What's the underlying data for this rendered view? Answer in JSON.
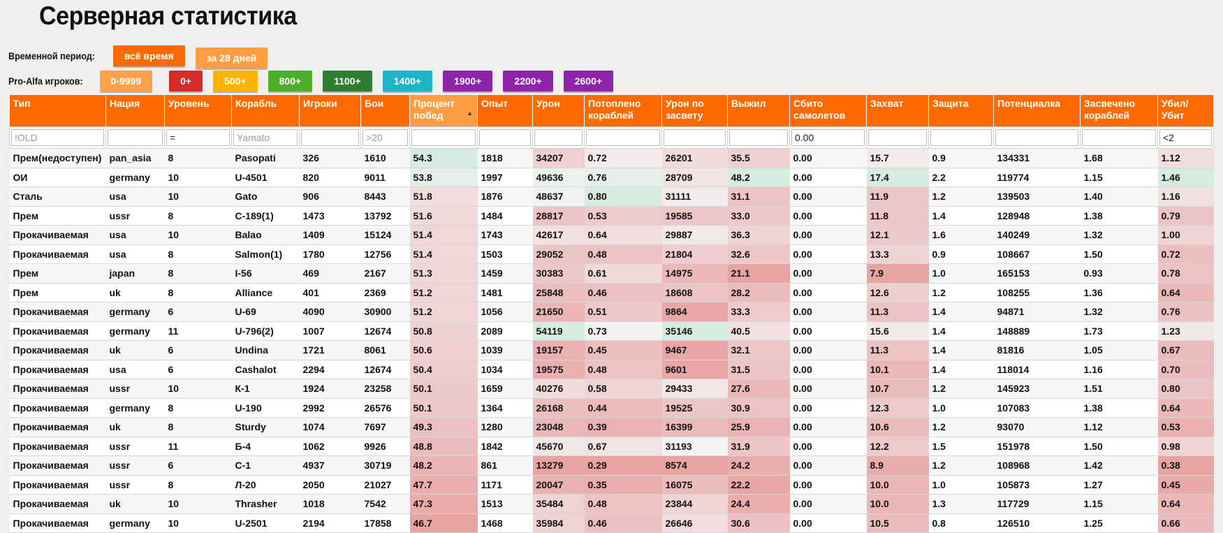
{
  "title": "Серверная статистика",
  "period": {
    "label": "Временной период:",
    "buttons": [
      {
        "label": "всё время",
        "color": "#ff6a00"
      },
      {
        "label": "за 28 дней",
        "color": "#ff9d45"
      }
    ]
  },
  "players": {
    "label": "Pro-Alfa игроков:",
    "buttons": [
      {
        "label": "0-9999",
        "color": "#ffa04a"
      },
      {
        "label": "0+",
        "color": "#d42b2b"
      },
      {
        "label": "500+",
        "color": "#ffb300"
      },
      {
        "label": "800+",
        "color": "#4caf2a"
      },
      {
        "label": "1100+",
        "color": "#2e7d32"
      },
      {
        "label": "1400+",
        "color": "#1eb5c9"
      },
      {
        "label": "1900+",
        "color": "#8e24aa"
      },
      {
        "label": "2200+",
        "color": "#8e24aa"
      },
      {
        "label": "2600+",
        "color": "#8e24aa"
      }
    ]
  },
  "columns": [
    {
      "label": "Тип",
      "filter": "",
      "placeholder": "!OLD"
    },
    {
      "label": "Нация",
      "filter": "",
      "placeholder": ""
    },
    {
      "label": "Уровень",
      "filter": "=",
      "placeholder": ""
    },
    {
      "label": "Корабль",
      "filter": "",
      "placeholder": "Yamato"
    },
    {
      "label": "Игроки",
      "filter": "",
      "placeholder": ""
    },
    {
      "label": "Бои",
      "filter": "",
      "placeholder": ">20"
    },
    {
      "label": "Процент побед",
      "filter": "",
      "placeholder": "",
      "sorted": true
    },
    {
      "label": "Опыт",
      "filter": "",
      "placeholder": ""
    },
    {
      "label": "Урон",
      "filter": "",
      "placeholder": ""
    },
    {
      "label": "Потоплено кораблей",
      "filter": "",
      "placeholder": ""
    },
    {
      "label": "Урон по засвету",
      "filter": "",
      "placeholder": ""
    },
    {
      "label": "Выжил",
      "filter": "",
      "placeholder": ""
    },
    {
      "label": "Сбито самолетов",
      "filter": "0.00",
      "placeholder": ""
    },
    {
      "label": "Захват",
      "filter": "",
      "placeholder": ""
    },
    {
      "label": "Защита",
      "filter": "",
      "placeholder": ""
    },
    {
      "label": "Потенциалка",
      "filter": "",
      "placeholder": ""
    },
    {
      "label": "Засвечено кораблей",
      "filter": "",
      "placeholder": ""
    },
    {
      "label": "Убил/ Убит",
      "filter": "<2",
      "placeholder": ""
    }
  ],
  "rows": [
    [
      "Прем(недоступен)",
      "pan_asia",
      "8",
      "Pasopati",
      "326",
      "1610",
      "54.3",
      "1818",
      "34207",
      "0.72",
      "26201",
      "35.5",
      "0.00",
      "15.7",
      "0.9",
      "134331",
      "1.68",
      "1.12"
    ],
    [
      "ОИ",
      "germany",
      "10",
      "U-4501",
      "820",
      "9011",
      "53.8",
      "1997",
      "49636",
      "0.76",
      "28709",
      "48.2",
      "0.00",
      "17.4",
      "2.2",
      "119774",
      "1.15",
      "1.46"
    ],
    [
      "Сталь",
      "usa",
      "10",
      "Gato",
      "906",
      "8443",
      "51.8",
      "1876",
      "48637",
      "0.80",
      "31111",
      "31.1",
      "0.00",
      "11.9",
      "1.2",
      "139503",
      "1.40",
      "1.16"
    ],
    [
      "Прем",
      "ussr",
      "8",
      "С-189(1)",
      "1473",
      "13792",
      "51.6",
      "1484",
      "28817",
      "0.53",
      "19585",
      "33.0",
      "0.00",
      "11.8",
      "1.4",
      "128948",
      "1.38",
      "0.79"
    ],
    [
      "Прокачиваемая",
      "usa",
      "10",
      "Balao",
      "1409",
      "15124",
      "51.4",
      "1743",
      "42617",
      "0.64",
      "29887",
      "36.3",
      "0.00",
      "12.1",
      "1.6",
      "140249",
      "1.32",
      "1.00"
    ],
    [
      "Прокачиваемая",
      "usa",
      "8",
      "Salmon(1)",
      "1780",
      "12756",
      "51.4",
      "1503",
      "29052",
      "0.48",
      "21804",
      "32.6",
      "0.00",
      "13.3",
      "0.9",
      "108667",
      "1.50",
      "0.72"
    ],
    [
      "Прем",
      "japan",
      "8",
      "I-56",
      "469",
      "2167",
      "51.3",
      "1459",
      "30383",
      "0.61",
      "14975",
      "21.1",
      "0.00",
      "7.9",
      "1.0",
      "165153",
      "0.93",
      "0.78"
    ],
    [
      "Прем",
      "uk",
      "8",
      "Alliance",
      "401",
      "2369",
      "51.2",
      "1481",
      "25848",
      "0.46",
      "18608",
      "28.2",
      "0.00",
      "12.6",
      "1.2",
      "108255",
      "1.36",
      "0.64"
    ],
    [
      "Прокачиваемая",
      "germany",
      "6",
      "U-69",
      "4090",
      "30900",
      "51.2",
      "1056",
      "21650",
      "0.51",
      "9864",
      "33.3",
      "0.00",
      "11.3",
      "1.4",
      "94871",
      "1.32",
      "0.76"
    ],
    [
      "Прокачиваемая",
      "germany",
      "11",
      "U-796(2)",
      "1007",
      "12674",
      "50.8",
      "2089",
      "54119",
      "0.73",
      "35146",
      "40.5",
      "0.00",
      "15.6",
      "1.4",
      "148889",
      "1.73",
      "1.23"
    ],
    [
      "Прокачиваемая",
      "uk",
      "6",
      "Undina",
      "1721",
      "8061",
      "50.6",
      "1039",
      "19157",
      "0.45",
      "9467",
      "32.1",
      "0.00",
      "11.3",
      "1.4",
      "81816",
      "1.05",
      "0.67"
    ],
    [
      "Прокачиваемая",
      "usa",
      "6",
      "Cashalot",
      "2294",
      "12674",
      "50.4",
      "1034",
      "19575",
      "0.48",
      "9601",
      "31.5",
      "0.00",
      "10.1",
      "1.4",
      "118014",
      "1.16",
      "0.70"
    ],
    [
      "Прокачиваемая",
      "ussr",
      "10",
      "К-1",
      "1924",
      "23258",
      "50.1",
      "1659",
      "40276",
      "0.58",
      "29433",
      "27.6",
      "0.00",
      "10.7",
      "1.2",
      "145923",
      "1.51",
      "0.80"
    ],
    [
      "Прокачиваемая",
      "germany",
      "8",
      "U-190",
      "2992",
      "26576",
      "50.1",
      "1364",
      "26168",
      "0.44",
      "19525",
      "30.9",
      "0.00",
      "12.3",
      "1.0",
      "107083",
      "1.38",
      "0.64"
    ],
    [
      "Прокачиваемая",
      "uk",
      "8",
      "Sturdy",
      "1074",
      "7697",
      "49.3",
      "1280",
      "23048",
      "0.39",
      "16399",
      "25.9",
      "0.00",
      "10.6",
      "1.2",
      "93070",
      "1.12",
      "0.53"
    ],
    [
      "Прокачиваемая",
      "ussr",
      "11",
      "Б-4",
      "1062",
      "9926",
      "48.8",
      "1842",
      "45670",
      "0.67",
      "31193",
      "31.9",
      "0.00",
      "12.2",
      "1.5",
      "151978",
      "1.50",
      "0.98"
    ],
    [
      "Прокачиваемая",
      "ussr",
      "6",
      "С-1",
      "4937",
      "30719",
      "48.2",
      "861",
      "13279",
      "0.29",
      "8574",
      "24.2",
      "0.00",
      "8.9",
      "1.2",
      "108968",
      "1.42",
      "0.38"
    ],
    [
      "Прокачиваемая",
      "ussr",
      "8",
      "Л-20",
      "2050",
      "21027",
      "47.7",
      "1171",
      "20047",
      "0.35",
      "16075",
      "22.2",
      "0.00",
      "10.0",
      "1.0",
      "105873",
      "1.27",
      "0.45"
    ],
    [
      "Прокачиваемая",
      "uk",
      "10",
      "Thrasher",
      "1018",
      "7542",
      "47.3",
      "1513",
      "35484",
      "0.48",
      "23844",
      "24.4",
      "0.00",
      "10.0",
      "1.3",
      "117729",
      "1.15",
      "0.64"
    ],
    [
      "Прокачиваемая",
      "germany",
      "10",
      "U-2501",
      "2194",
      "17858",
      "46.7",
      "1468",
      "35984",
      "0.46",
      "26646",
      "30.6",
      "0.00",
      "10.5",
      "0.8",
      "126510",
      "1.25",
      "0.66"
    ]
  ],
  "heat": {
    "good": "#d7ece0",
    "bad": "#e8a3a3"
  }
}
